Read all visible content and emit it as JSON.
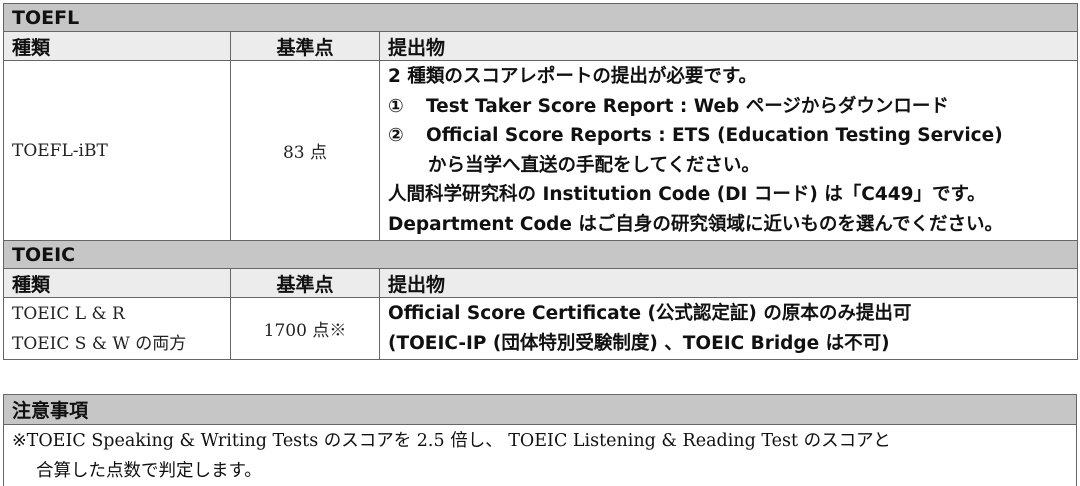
{
  "toefl": {
    "section_title": "TOEFL",
    "headers": {
      "type": "種類",
      "score": "基準点",
      "submission": "提出物"
    },
    "type": "TOEFL-iBT",
    "score": "83 点",
    "lines": [
      "2 種類のスコアレポートの提出が必要です。",
      "①",
      "Test Taker Score Report : Web ページからダウンロード",
      "②",
      "Official Score Reports : ETS (Education Testing Service)",
      "から当学へ直送の手配をしてください。",
      "人間科学研究科の Institution Code (DI コード) は「C449」です。",
      "Department Code はご自身の研究領域に近いものを選んでください。"
    ]
  },
  "toeic": {
    "section_title": "TOEIC",
    "headers": {
      "type": "種類",
      "score": "基準点",
      "submission": "提出物"
    },
    "type_lines": [
      "TOEIC L & R",
      "TOEIC S & W の両方"
    ],
    "score": "1700 点※",
    "lines": [
      "Official Score Certificate (公式認定証) の原本のみ提出可",
      "(TOEIC-IP (団体特別受験制度) 、TOEIC Bridge は不可)"
    ]
  },
  "notes": {
    "title": "注意事項",
    "lines": [
      "※TOEIC Speaking & Writing Tests のスコアを 2.5 倍し、 TOEIC Listening & Reading Test のスコアと",
      "合算した点数で判定します。"
    ]
  }
}
